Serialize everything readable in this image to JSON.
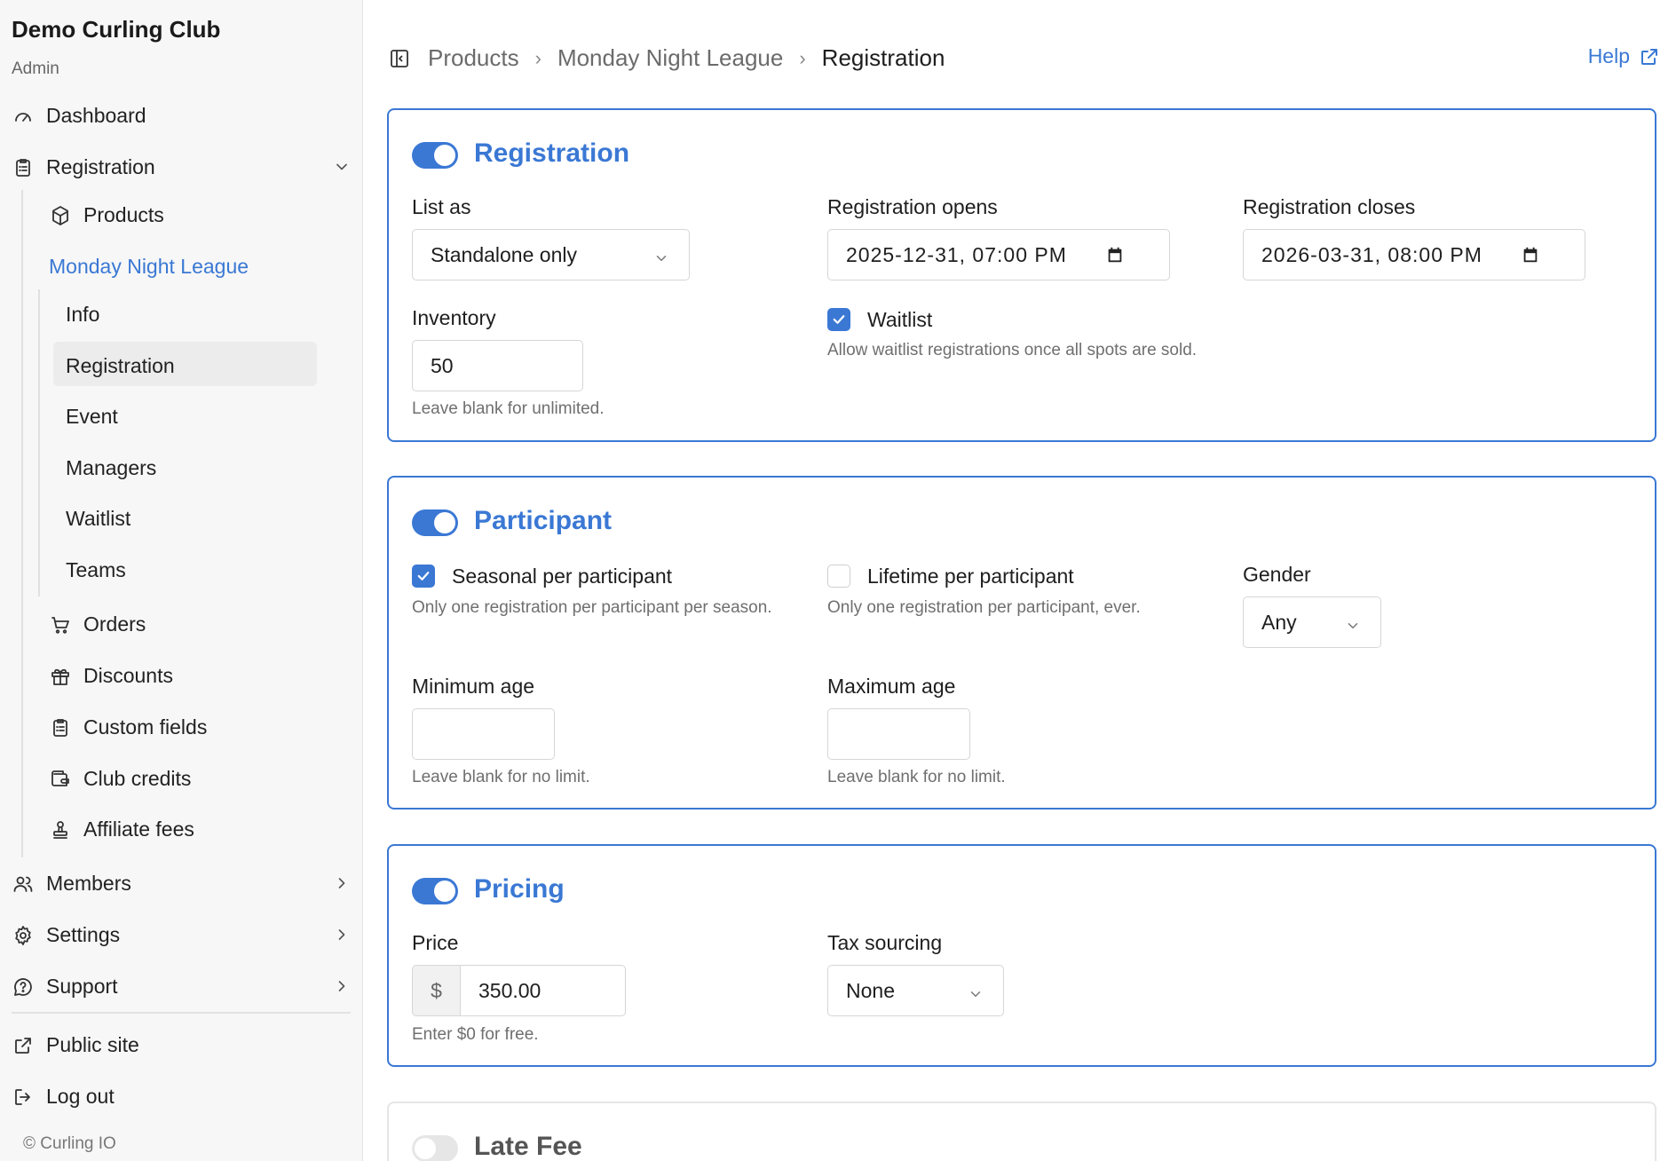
{
  "sidebar": {
    "brand": "Demo Curling Club",
    "role": "Admin",
    "dashboard": "Dashboard",
    "registration": "Registration",
    "products": "Products",
    "product_name": "Monday Night League",
    "sub": {
      "info": "Info",
      "registration": "Registration",
      "event": "Event",
      "managers": "Managers",
      "waitlist": "Waitlist",
      "teams": "Teams"
    },
    "orders": "Orders",
    "discounts": "Discounts",
    "custom_fields": "Custom fields",
    "club_credits": "Club credits",
    "affiliate_fees": "Affiliate fees",
    "members": "Members",
    "settings": "Settings",
    "support": "Support",
    "public_site": "Public site",
    "log_out": "Log out",
    "copyright": "© Curling IO"
  },
  "breadcrumb": {
    "items": [
      "Products",
      "Monday Night League",
      "Registration"
    ],
    "help": "Help"
  },
  "registration": {
    "title": "Registration",
    "enabled": true,
    "list_as_label": "List as",
    "list_as_value": "Standalone only",
    "opens_label": "Registration opens",
    "opens_value": "2025-12-31, 07:00 PM",
    "closes_label": "Registration closes",
    "closes_value": "2026-03-31, 08:00 PM",
    "inventory_label": "Inventory",
    "inventory_value": "50",
    "inventory_hint": "Leave blank for unlimited.",
    "waitlist_label": "Waitlist",
    "waitlist_checked": true,
    "waitlist_hint": "Allow waitlist registrations once all spots are sold."
  },
  "participant": {
    "title": "Participant",
    "enabled": true,
    "seasonal_label": "Seasonal per participant",
    "seasonal_checked": true,
    "seasonal_hint": "Only one registration per participant per season.",
    "lifetime_label": "Lifetime per participant",
    "lifetime_checked": false,
    "lifetime_hint": "Only one registration per participant, ever.",
    "gender_label": "Gender",
    "gender_value": "Any",
    "min_age_label": "Minimum age",
    "min_age_value": "",
    "min_age_hint": "Leave blank for no limit.",
    "max_age_label": "Maximum age",
    "max_age_value": "",
    "max_age_hint": "Leave blank for no limit."
  },
  "pricing": {
    "title": "Pricing",
    "enabled": true,
    "price_label": "Price",
    "currency": "$",
    "price_value": "350.00",
    "price_hint": "Enter $0 for free.",
    "tax_label": "Tax sourcing",
    "tax_value": "None"
  },
  "late_fee": {
    "title": "Late Fee",
    "enabled": false
  },
  "colors": {
    "accent": "#3a78d4",
    "sidebar_bg": "#f7f7f7",
    "active_item_bg": "#ececec"
  }
}
